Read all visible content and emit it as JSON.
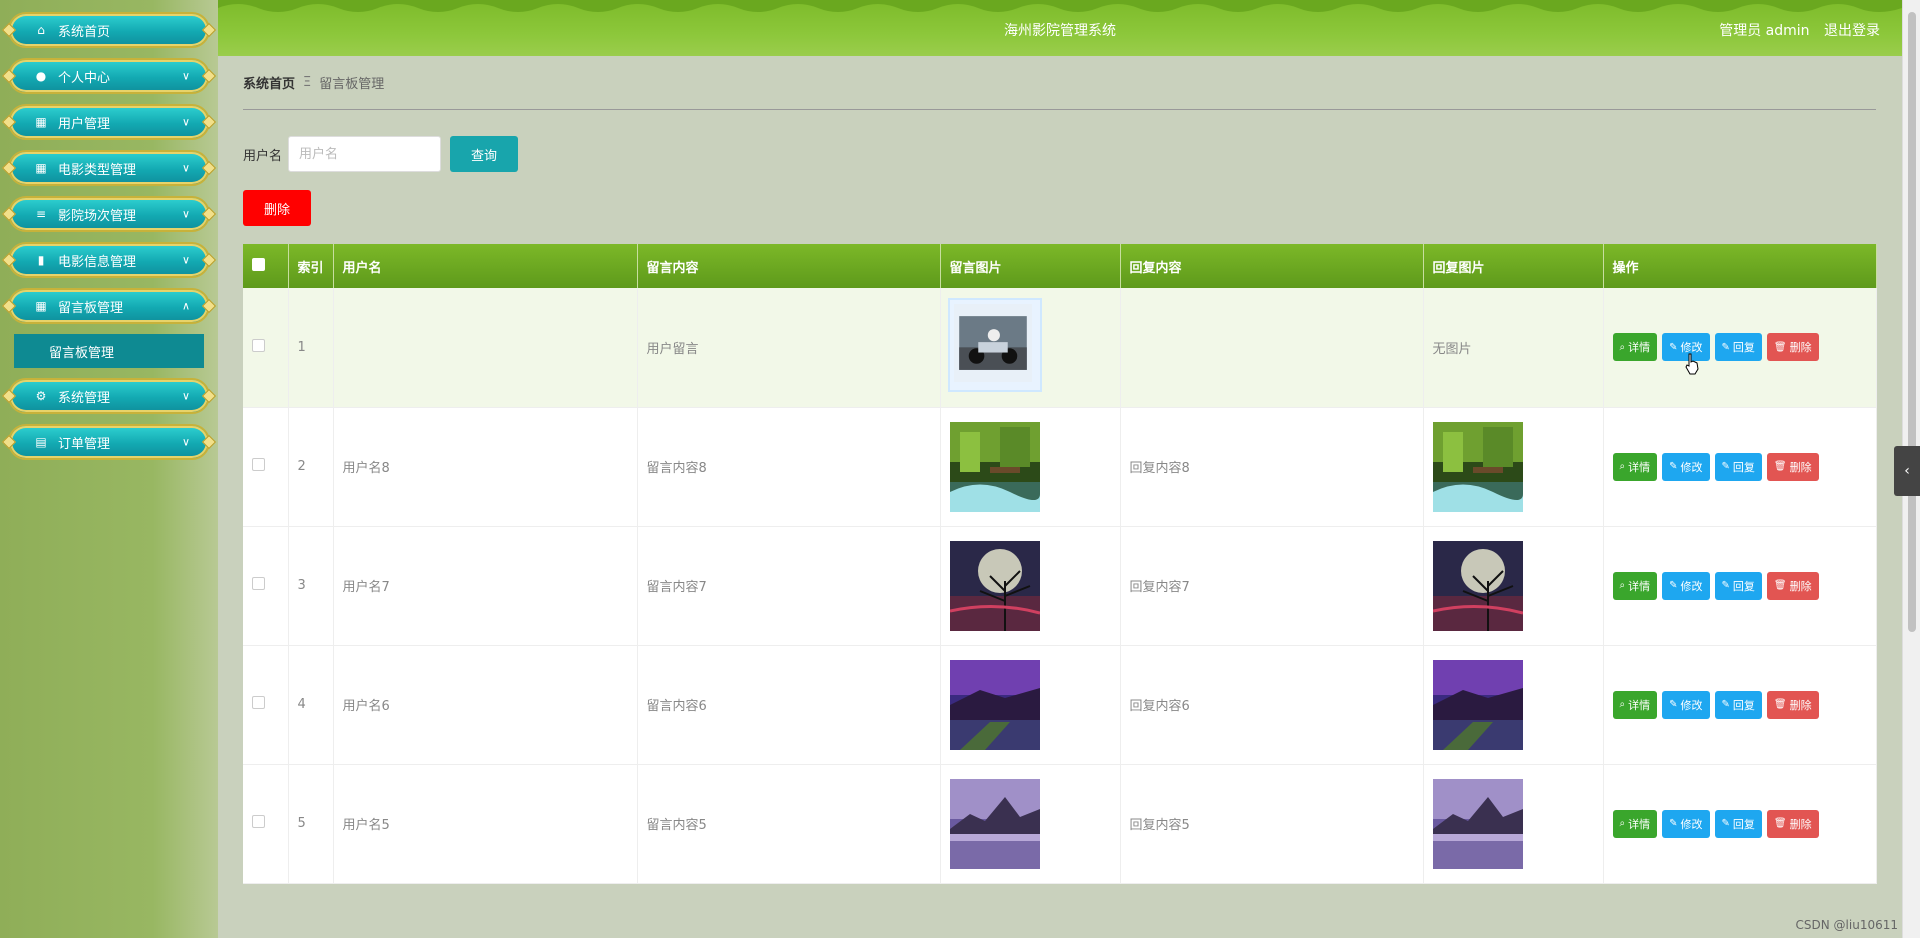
{
  "app": {
    "title": "海州影院管理系统",
    "user_label": "管理员 admin",
    "logout_label": "退出登录"
  },
  "sidebar": {
    "items": [
      {
        "label": "系统首页",
        "icon": "home-icon",
        "chevron": ""
      },
      {
        "label": "个人中心",
        "icon": "user-icon",
        "chevron": "∨"
      },
      {
        "label": "用户管理",
        "icon": "grid-icon",
        "chevron": "∨"
      },
      {
        "label": "电影类型管理",
        "icon": "grid-icon",
        "chevron": "∨"
      },
      {
        "label": "影院场次管理",
        "icon": "sliders-icon",
        "chevron": "∨"
      },
      {
        "label": "电影信息管理",
        "icon": "chart-icon",
        "chevron": "∨"
      },
      {
        "label": "留言板管理",
        "icon": "grid-icon",
        "chevron": "∧"
      }
    ],
    "submenu": {
      "label": "留言板管理"
    },
    "items_after": [
      {
        "label": "系统管理",
        "icon": "settings-icon",
        "chevron": "∨"
      },
      {
        "label": "订单管理",
        "icon": "clipboard-icon",
        "chevron": "∨"
      }
    ]
  },
  "breadcrumb": {
    "home": "系统首页",
    "separator": "Ξ",
    "current": "留言板管理"
  },
  "search": {
    "label": "用户名",
    "placeholder": "用户名",
    "button": "查询"
  },
  "bulk_delete_label": "删除",
  "table": {
    "columns": [
      "索引",
      "用户名",
      "留言内容",
      "留言图片",
      "回复内容",
      "回复图片",
      "操作"
    ],
    "rows": [
      {
        "index": "1",
        "username": "",
        "content": "用户留言",
        "image": "motorcycle",
        "reply": "",
        "reply_image": "none",
        "reply_image_text": "无图片"
      },
      {
        "index": "2",
        "username": "用户名8",
        "content": "留言内容8",
        "image": "forest",
        "reply": "回复内容8",
        "reply_image": "forest",
        "reply_image_text": ""
      },
      {
        "index": "3",
        "username": "用户名7",
        "content": "留言内容7",
        "image": "moon",
        "reply": "回复内容7",
        "reply_image": "moon",
        "reply_image_text": ""
      },
      {
        "index": "4",
        "username": "用户名6",
        "content": "留言内容6",
        "image": "coast",
        "reply": "回复内容6",
        "reply_image": "coast",
        "reply_image_text": ""
      },
      {
        "index": "5",
        "username": "用户名5",
        "content": "留言内容5",
        "image": "mountain",
        "reply": "回复内容5",
        "reply_image": "mountain",
        "reply_image_text": ""
      }
    ],
    "actions": {
      "detail": "详情",
      "edit": "修改",
      "reply": "回复",
      "delete": "删除"
    }
  },
  "watermark": "CSDN @liu10611",
  "colors": {
    "header": "#8cc73a",
    "table_header": "#6aaa20",
    "menu": "#13a9b2",
    "query_button": "#18a5ac",
    "delete_button": "#ff0000",
    "detail_button": "#3aa62c",
    "edit_button": "#1ea7f0",
    "row_delete_button": "#e25552"
  }
}
